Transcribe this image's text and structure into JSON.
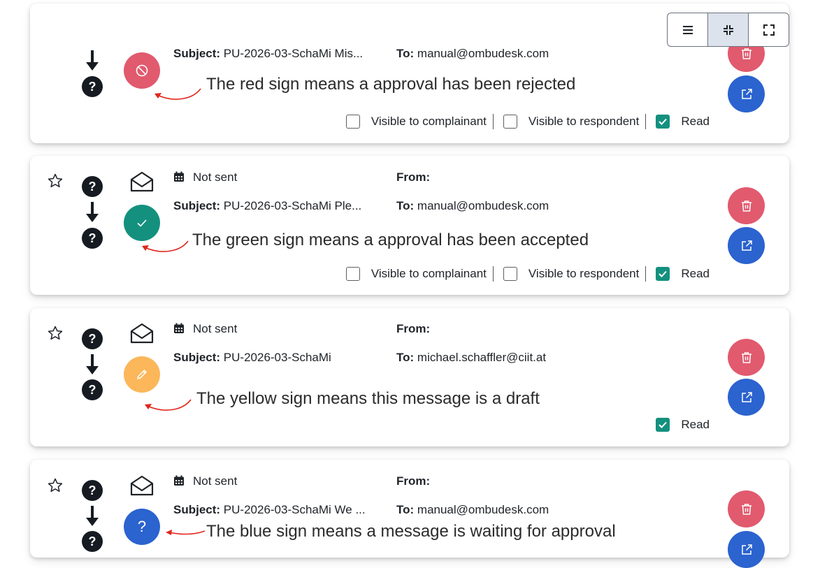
{
  "toolbar": {
    "icons": [
      "list-icon",
      "collapse-icon",
      "expand-icon"
    ]
  },
  "colors": {
    "rejected": "#e15a6e",
    "accepted": "#14907f",
    "draft": "#fbb75a",
    "pending": "#2b63cf",
    "delete": "#e15a6e",
    "open": "#2b63cf",
    "annotation_arrow": "#e0261b"
  },
  "labels": {
    "subject": "Subject:",
    "to": "To:",
    "from": "From:",
    "not_sent": "Not sent",
    "visible_complainant": "Visible to complainant",
    "visible_respondent": "Visible to respondent",
    "read": "Read"
  },
  "messages": [
    {
      "status": "rejected",
      "status_icon": "ban-icon",
      "subject": "PU-2026-03-SchaMi Mis...",
      "to": "manual@ombudesk.com",
      "annotation": "The red sign means a approval has been rejected",
      "visible_to_complainant": false,
      "visible_to_respondent": false,
      "read": true
    },
    {
      "status": "accepted",
      "status_icon": "check-icon",
      "sent_status": "Not sent",
      "from": "",
      "subject": "PU-2026-03-SchaMi Ple...",
      "to": "manual@ombudesk.com",
      "annotation": "The green sign means a approval has been accepted",
      "visible_to_complainant": false,
      "visible_to_respondent": false,
      "read": true
    },
    {
      "status": "draft",
      "status_icon": "pencil-icon",
      "sent_status": "Not sent",
      "from": "",
      "subject": "PU-2026-03-SchaMi",
      "to": "michael.schaffler@ciit.at",
      "annotation": "The yellow sign means this message is a draft",
      "read": true
    },
    {
      "status": "pending",
      "status_icon": "question-icon",
      "status_glyph": "?",
      "sent_status": "Not sent",
      "from": "",
      "subject": "PU-2026-03-SchaMi We ...",
      "to": "manual@ombudesk.com",
      "annotation": "The blue sign means a message is waiting for approval"
    }
  ],
  "question_glyph": "?"
}
